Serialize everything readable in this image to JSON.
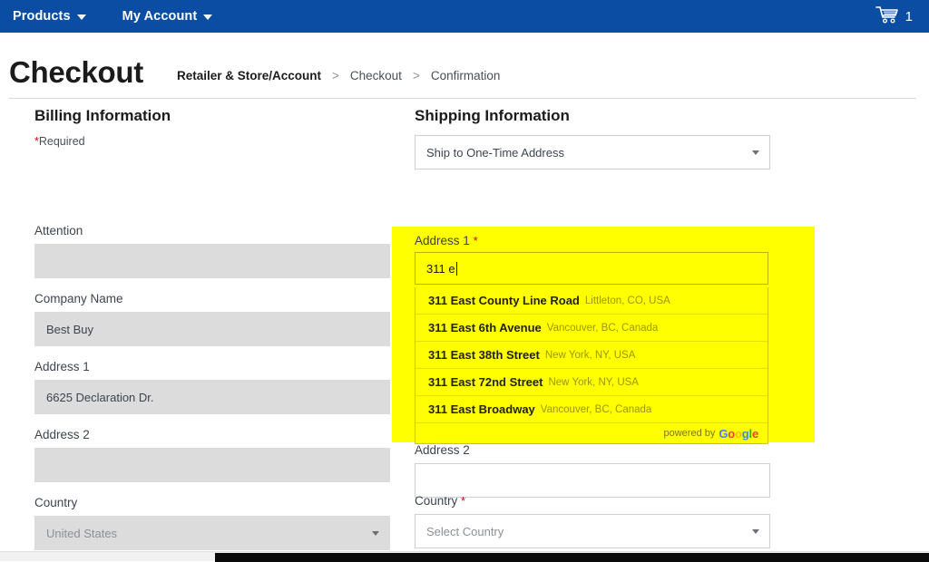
{
  "navbar": {
    "items": [
      {
        "label": "Products",
        "icon": "chevron-down-icon"
      },
      {
        "label": "My Account",
        "icon": "chevron-down-icon"
      }
    ],
    "cart": {
      "icon": "shopping-cart-icon",
      "count": "1"
    },
    "background_color": "#0b4da2"
  },
  "header": {
    "title": "Checkout",
    "breadcrumb": {
      "current": "Retailer & Store/Account",
      "separator": ">",
      "steps": [
        "Checkout",
        "Confirmation"
      ]
    }
  },
  "billing": {
    "section_title": "Billing Information",
    "required_note": "Required",
    "required_star": "*",
    "fields": [
      {
        "label": "Attention",
        "value": "",
        "placeholder": "",
        "type": "text",
        "disabled": true
      },
      {
        "label": "Company Name",
        "value": "Best Buy",
        "placeholder": "",
        "type": "text",
        "disabled": true
      },
      {
        "label": "Address 1",
        "value": "6625 Declaration Dr.",
        "placeholder": "",
        "type": "text",
        "disabled": true
      },
      {
        "label": "Address 2",
        "value": "",
        "placeholder": "",
        "type": "text",
        "disabled": true
      },
      {
        "label": "Country",
        "value": "United States",
        "placeholder": "United States",
        "type": "select",
        "disabled": true
      }
    ]
  },
  "shipping": {
    "section_title": "Shipping Information",
    "ship_mode": {
      "label": "",
      "value": "Ship to One-Time Address",
      "icon": "chevron-down-icon"
    },
    "address1": {
      "label": "Address 1",
      "required_star": "*",
      "value": "311 e",
      "focused": true
    },
    "address2": {
      "label": "Address 2",
      "value": "",
      "placeholder": ""
    },
    "country": {
      "label": "Country",
      "required_star": "*",
      "value": "Select Country",
      "icon": "chevron-down-icon"
    }
  },
  "autocomplete": {
    "visible": true,
    "suggestions": [
      {
        "main": "311 East County Line Road",
        "sub": "Littleton, CO, USA"
      },
      {
        "main": "311 East 6th Avenue",
        "sub": "Vancouver, BC, Canada"
      },
      {
        "main": "311 East 38th Street",
        "sub": "New York, NY, USA"
      },
      {
        "main": "311 East 72nd Street",
        "sub": "New York, NY, USA"
      },
      {
        "main": "311 East Broadway",
        "sub": "Vancouver, BC, Canada"
      }
    ],
    "footer": {
      "prefix": "powered by",
      "brand": "Google",
      "brand_letters": [
        {
          "char": "G",
          "color": "#4285f4"
        },
        {
          "char": "o",
          "color": "#ea4335"
        },
        {
          "char": "o",
          "color": "#fbbc05"
        },
        {
          "char": "g",
          "color": "#4285f4"
        },
        {
          "char": "l",
          "color": "#34a853"
        },
        {
          "char": "e",
          "color": "#ea4335"
        }
      ]
    }
  },
  "highlight": {
    "color": "#ffff00",
    "description": "annotation-highlight-shipping-address"
  },
  "scrollbar": {
    "orientation": "horizontal",
    "thumb_color": "#0a0a0a"
  }
}
